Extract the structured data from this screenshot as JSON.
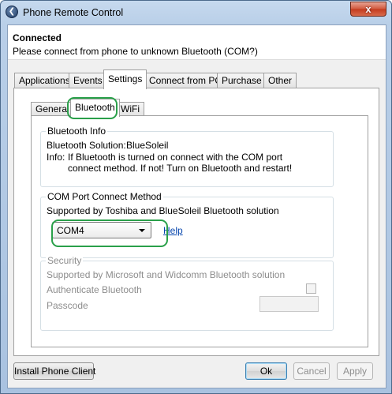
{
  "window": {
    "title": "Phone Remote Control",
    "close_glyph": "x"
  },
  "status": {
    "title": "Connected",
    "message": "Please connect from phone to unknown Bluetooth (COM?)"
  },
  "main_tabs": [
    {
      "label": "Applications",
      "active": false
    },
    {
      "label": "Events",
      "active": false
    },
    {
      "label": "Settings",
      "active": true
    },
    {
      "label": "Connect from PC",
      "active": false
    },
    {
      "label": "Purchase",
      "active": false
    },
    {
      "label": "Other",
      "active": false
    }
  ],
  "sub_tabs": [
    {
      "label": "General",
      "active": false
    },
    {
      "label": "Bluetooth",
      "active": true
    },
    {
      "label": "WiFi",
      "active": false
    }
  ],
  "bluetooth_info": {
    "title": "Bluetooth Info",
    "solution_label": "Bluetooth Solution:",
    "solution_value": "BlueSoleil",
    "info_label": "Info:",
    "info_line1": "If Bluetooth is turned on connect with the COM port",
    "info_line2": "connect method. If not! Turn on Bluetooth and restart!"
  },
  "com_port": {
    "title": "COM Port Connect Method",
    "supported": "Supported by Toshiba and BlueSoleil Bluetooth solution",
    "selected": "COM4",
    "help_link": "Help"
  },
  "security": {
    "title": "Security",
    "supported": "Supported by Microsoft and Widcomm Bluetooth solution",
    "authenticate_label": "Authenticate Bluetooth",
    "authenticate_checked": false,
    "passcode_label": "Passcode",
    "passcode_value": ""
  },
  "buttons": {
    "install": "Install Phone Client",
    "ok": "Ok",
    "cancel": "Cancel",
    "apply": "Apply"
  },
  "colors": {
    "highlight": "#2aa04a",
    "link": "#0645ad"
  }
}
